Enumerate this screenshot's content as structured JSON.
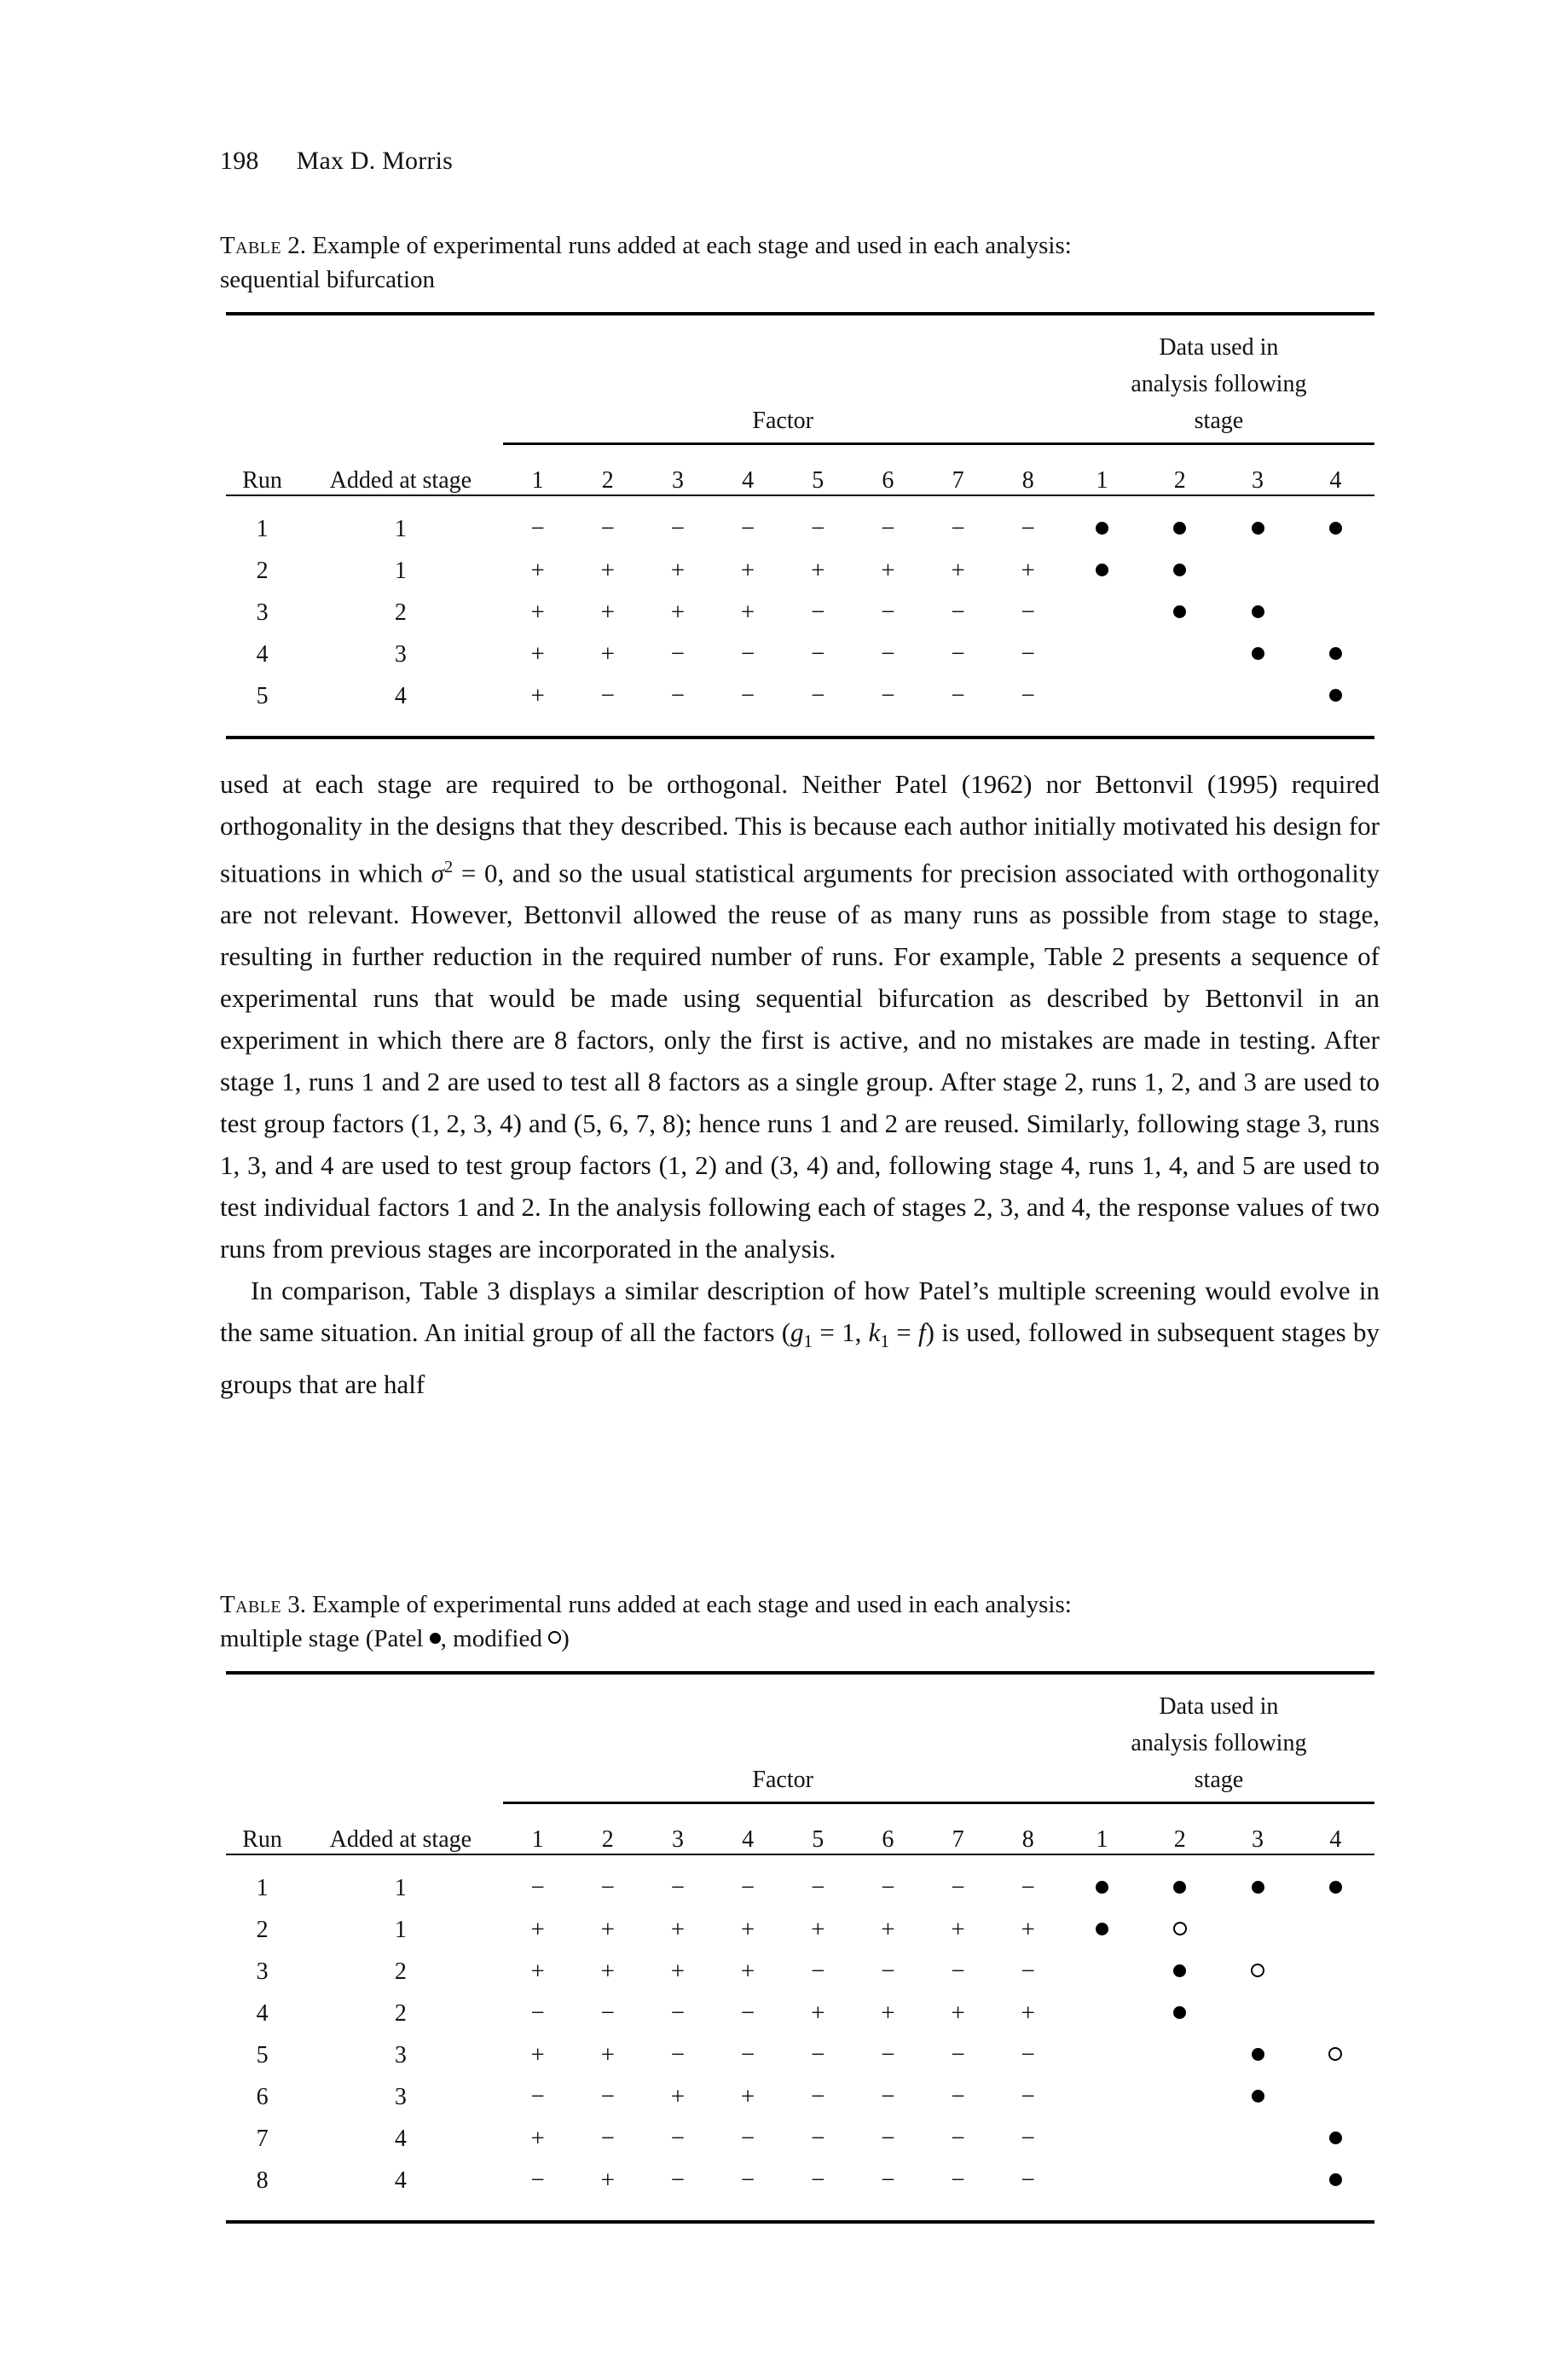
{
  "running_head": {
    "page_number": "198",
    "author": "Max D. Morris"
  },
  "table2": {
    "label": "Table",
    "number": "2.",
    "caption_line1": "Example of experimental runs added at each stage and used in each analysis:",
    "caption_line2": "sequential bifurcation",
    "group_headers": {
      "factor": "Factor",
      "analysis_line1": "Data used in",
      "analysis_line2": "analysis following",
      "analysis_line3": "stage"
    },
    "columns": {
      "run": "Run",
      "added_at_stage": "Added at stage",
      "factors": [
        "1",
        "2",
        "3",
        "4",
        "5",
        "6",
        "7",
        "8"
      ],
      "stages": [
        "1",
        "2",
        "3",
        "4"
      ]
    },
    "rows": [
      {
        "run": "1",
        "added_at_stage": "1",
        "factors": [
          "−",
          "−",
          "−",
          "−",
          "−",
          "−",
          "−",
          "−"
        ],
        "analysis": [
          "filled",
          "filled",
          "filled",
          "filled"
        ]
      },
      {
        "run": "2",
        "added_at_stage": "1",
        "factors": [
          "+",
          "+",
          "+",
          "+",
          "+",
          "+",
          "+",
          "+"
        ],
        "analysis": [
          "filled",
          "filled",
          "",
          ""
        ]
      },
      {
        "run": "3",
        "added_at_stage": "2",
        "factors": [
          "+",
          "+",
          "+",
          "+",
          "−",
          "−",
          "−",
          "−"
        ],
        "analysis": [
          "",
          "filled",
          "filled",
          ""
        ]
      },
      {
        "run": "4",
        "added_at_stage": "3",
        "factors": [
          "+",
          "+",
          "−",
          "−",
          "−",
          "−",
          "−",
          "−"
        ],
        "analysis": [
          "",
          "",
          "filled",
          "filled"
        ]
      },
      {
        "run": "5",
        "added_at_stage": "4",
        "factors": [
          "+",
          "−",
          "−",
          "−",
          "−",
          "−",
          "−",
          "−"
        ],
        "analysis": [
          "",
          "",
          "",
          "filled"
        ]
      }
    ]
  },
  "body": {
    "paragraph1": "used at each stage are required to be orthogonal. Neither Patel (1962) nor Bettonvil (1995) required orthogonality in the designs that they described. This is because each author initially motivated his design for situations in which ",
    "paragraph1_math": "σ",
    "paragraph1_sup": "2",
    "paragraph1_cont": " = 0, and so the usual statistical arguments for precision associated with orthogonality are not relevant. However, Bettonvil allowed the reuse of as many runs as possible from stage to stage, resulting in further reduction in the required number of runs. For example, Table 2 presents a sequence of experimental runs that would be made using sequential bifurcation as described by Bettonvil in an experiment in which there are 8 factors, only the first is active, and no mistakes are made in testing. After stage 1, runs 1 and 2 are used to test all 8 factors as a single group. After stage 2, runs 1, 2, and 3 are used to test group factors (1, 2, 3, 4) and (5, 6, 7, 8); hence runs 1 and 2 are reused. Similarly, following stage 3, runs 1, 3, and 4 are used to test group factors (1, 2) and (3, 4) and, following stage 4, runs 1, 4, and 5 are used to test individual factors 1 and 2. In the analysis following each of stages 2, 3, and 4, the response values of two runs from previous stages are incorporated in the analysis.",
    "paragraph2_start": "In comparison, Table 3 displays a similar description of how Patel’s multiple screening would evolve in the same situation. An initial group of all the factors (",
    "paragraph2_g": "g",
    "paragraph2_g_sub": "1",
    "paragraph2_eq1": " = 1, ",
    "paragraph2_k": "k",
    "paragraph2_k_sub": "1",
    "paragraph2_eq2": " = ",
    "paragraph2_f": "f",
    "paragraph2_end": ") is used, followed in subsequent stages by groups that are half"
  },
  "table3": {
    "label": "Table",
    "number": "3.",
    "caption_line1": "Example of experimental runs added at each stage and used in each analysis:",
    "caption_line2_a": "multiple stage (Patel ",
    "caption_line2_b": ", modified ",
    "caption_line2_c": ")",
    "group_headers": {
      "factor": "Factor",
      "analysis_line1": "Data used in",
      "analysis_line2": "analysis following",
      "analysis_line3": "stage"
    },
    "columns": {
      "run": "Run",
      "added_at_stage": "Added at stage",
      "factors": [
        "1",
        "2",
        "3",
        "4",
        "5",
        "6",
        "7",
        "8"
      ],
      "stages": [
        "1",
        "2",
        "3",
        "4"
      ]
    },
    "rows": [
      {
        "run": "1",
        "added_at_stage": "1",
        "factors": [
          "−",
          "−",
          "−",
          "−",
          "−",
          "−",
          "−",
          "−"
        ],
        "analysis": [
          "filled",
          "filled",
          "filled",
          "filled"
        ]
      },
      {
        "run": "2",
        "added_at_stage": "1",
        "factors": [
          "+",
          "+",
          "+",
          "+",
          "+",
          "+",
          "+",
          "+"
        ],
        "analysis": [
          "filled",
          "open",
          "",
          ""
        ]
      },
      {
        "run": "3",
        "added_at_stage": "2",
        "factors": [
          "+",
          "+",
          "+",
          "+",
          "−",
          "−",
          "−",
          "−"
        ],
        "analysis": [
          "",
          "filled",
          "open",
          ""
        ]
      },
      {
        "run": "4",
        "added_at_stage": "2",
        "factors": [
          "−",
          "−",
          "−",
          "−",
          "+",
          "+",
          "+",
          "+"
        ],
        "analysis": [
          "",
          "filled",
          "",
          ""
        ]
      },
      {
        "run": "5",
        "added_at_stage": "3",
        "factors": [
          "+",
          "+",
          "−",
          "−",
          "−",
          "−",
          "−",
          "−"
        ],
        "analysis": [
          "",
          "",
          "filled",
          "open"
        ]
      },
      {
        "run": "6",
        "added_at_stage": "3",
        "factors": [
          "−",
          "−",
          "+",
          "+",
          "−",
          "−",
          "−",
          "−"
        ],
        "analysis": [
          "",
          "",
          "filled",
          ""
        ]
      },
      {
        "run": "7",
        "added_at_stage": "4",
        "factors": [
          "+",
          "−",
          "−",
          "−",
          "−",
          "−",
          "−",
          "−"
        ],
        "analysis": [
          "",
          "",
          "",
          "filled"
        ]
      },
      {
        "run": "8",
        "added_at_stage": "4",
        "factors": [
          "−",
          "+",
          "−",
          "−",
          "−",
          "−",
          "−",
          "−"
        ],
        "analysis": [
          "",
          "",
          "",
          "filled"
        ]
      }
    ]
  }
}
